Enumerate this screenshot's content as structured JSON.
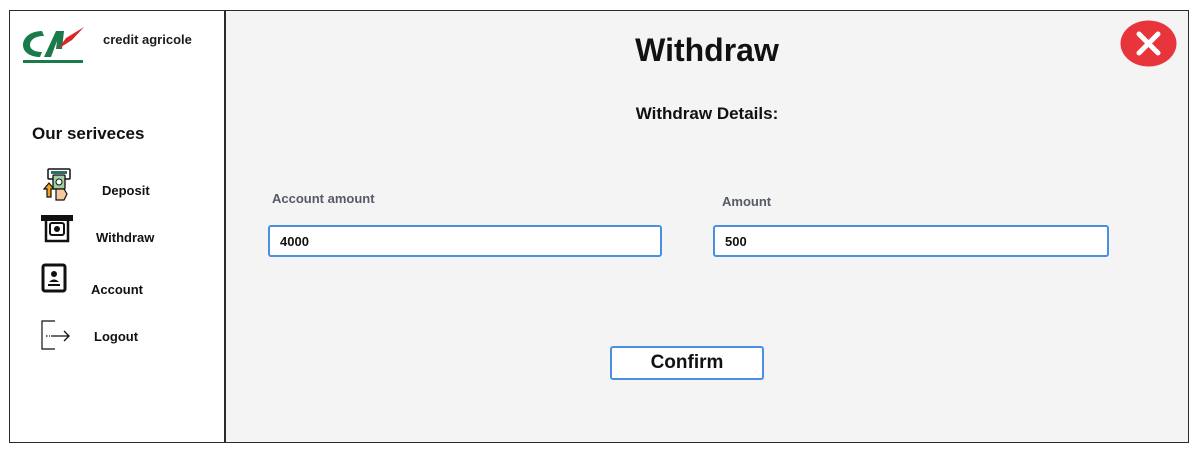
{
  "brand": {
    "name": "credit agricole",
    "logo_icon": "credit-agricole-logo"
  },
  "sidebar": {
    "section_title": "Our seriveces",
    "items": [
      {
        "label": "Deposit",
        "icon": "deposit-icon"
      },
      {
        "label": "Withdraw",
        "icon": "withdraw-icon"
      },
      {
        "label": "Account",
        "icon": "account-icon"
      },
      {
        "label": "Logout",
        "icon": "logout-icon"
      }
    ]
  },
  "main": {
    "title": "Withdraw",
    "subtitle": "Withdraw Details:",
    "fields": {
      "account_amount": {
        "label": "Account amount",
        "value": "4000"
      },
      "amount": {
        "label": "Amount",
        "value": "500"
      }
    },
    "confirm_label": "Confirm"
  },
  "colors": {
    "accent_border": "#4a8fe0",
    "close_red": "#e8343b",
    "panel_bg": "#f4f4f4",
    "logo_green": "#1a7a4a",
    "logo_red": "#d9262e"
  }
}
